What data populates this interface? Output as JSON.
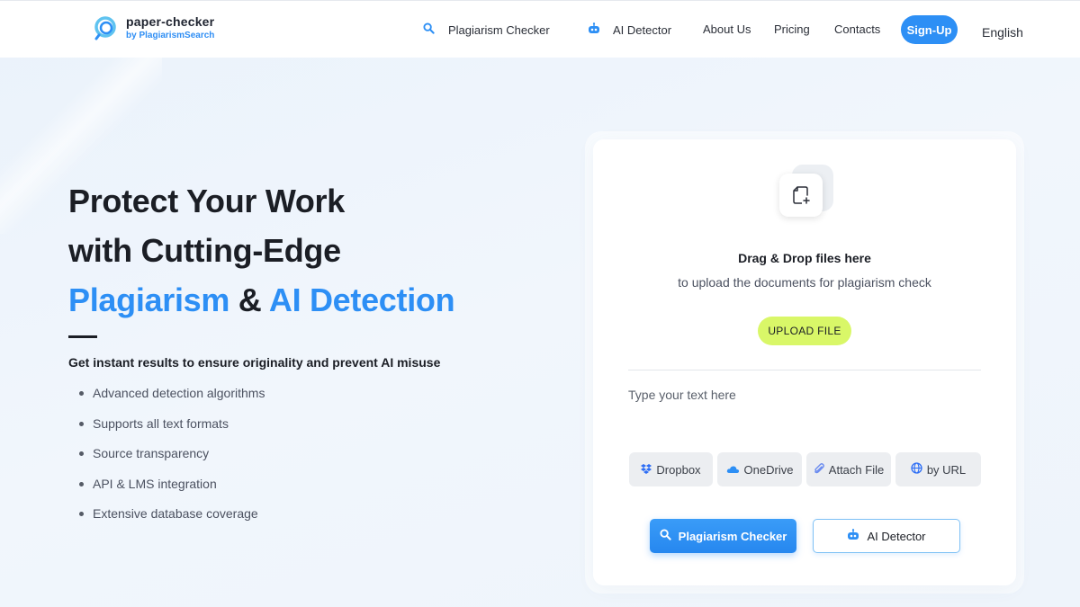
{
  "header": {
    "logo_name": "paper-checker",
    "logo_sub": "by PlagiarismSearch",
    "nav": {
      "plagiarism_checker": "Plagiarism Checker",
      "ai_detector": "AI Detector",
      "about_us": "About Us",
      "pricing": "Pricing",
      "contacts": "Contacts"
    },
    "signup_label": "Sign-Up",
    "language": "English"
  },
  "hero": {
    "title_line1": "Protect Your Work",
    "title_line2": "with Cutting-Edge",
    "title_accent1": "Plagiarism",
    "title_amp": "&",
    "title_accent2": "AI Detection",
    "subtitle": "Get instant results to ensure originality and prevent AI misuse",
    "features": [
      "Advanced detection algorithms",
      "Supports all text formats",
      "Source transparency",
      "API & LMS integration",
      "Extensive database coverage"
    ]
  },
  "upload": {
    "drag_title": "Drag & Drop files here",
    "drag_sub": "to upload the documents for plagiarism check",
    "upload_button": "UPLOAD FILE",
    "text_placeholder": "Type your text here",
    "sources": {
      "dropbox": "Dropbox",
      "onedrive": "OneDrive",
      "attach": "Attach File",
      "url": "by URL"
    },
    "actions": {
      "plagiarism": "Plagiarism Checker",
      "ai": "AI Detector"
    }
  },
  "colors": {
    "accent": "#2d8ff5",
    "upload_button": "#d9f768",
    "text_dark": "#1b1e25"
  }
}
